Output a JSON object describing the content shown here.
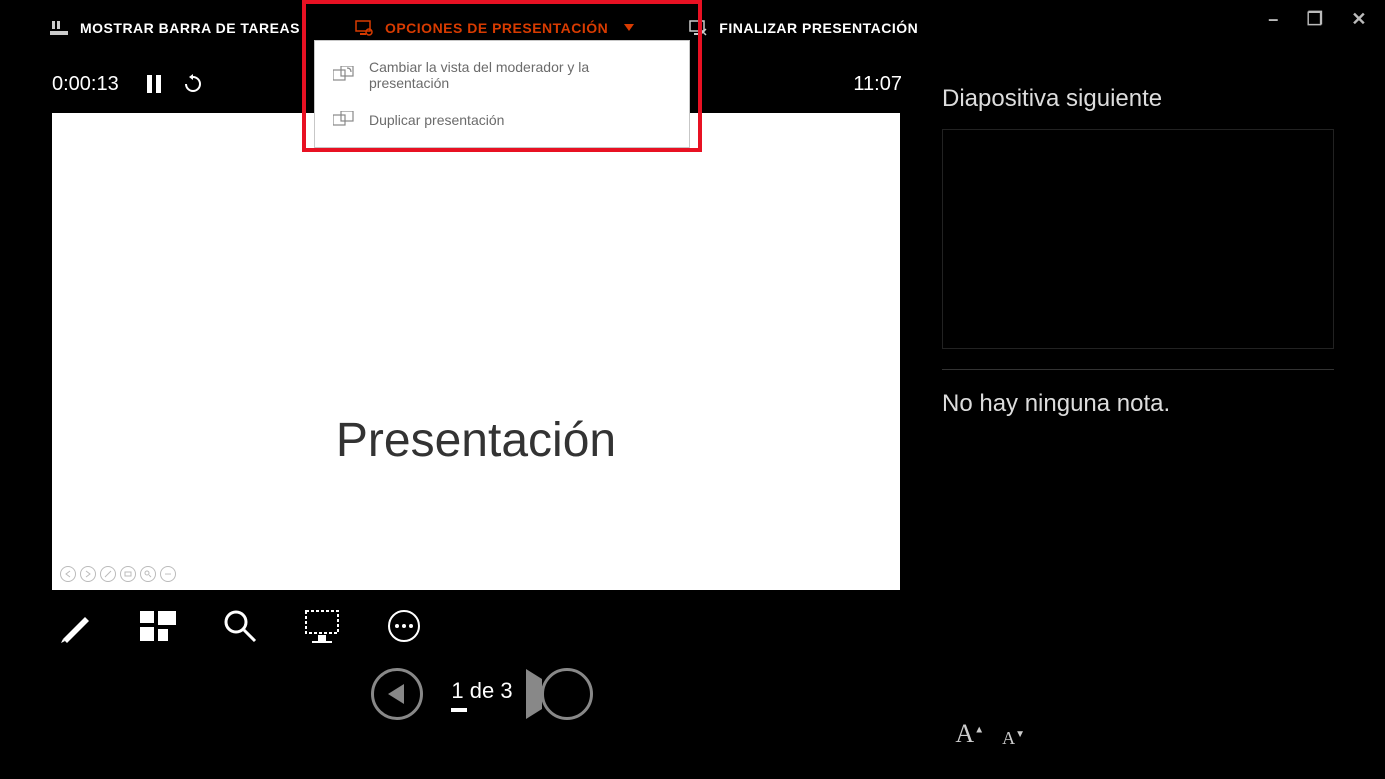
{
  "topbar": {
    "show_taskbar": "MOSTRAR BARRA DE TAREAS",
    "presentation_options": "OPCIONES DE PRESENTACIÓN",
    "end_presentation": "FINALIZAR PRESENTACIÓN"
  },
  "dropdown": {
    "swap_views": "Cambiar la vista del moderador y la presentación",
    "duplicate": "Duplicar presentación"
  },
  "status": {
    "elapsed": "0:00:13",
    "clock": "11:07"
  },
  "slide": {
    "title": "Presentación"
  },
  "nav": {
    "counter": "1 de 3"
  },
  "sidebar": {
    "next_slide": "Diapositiva siguiente",
    "no_notes": "No hay ninguna nota."
  }
}
